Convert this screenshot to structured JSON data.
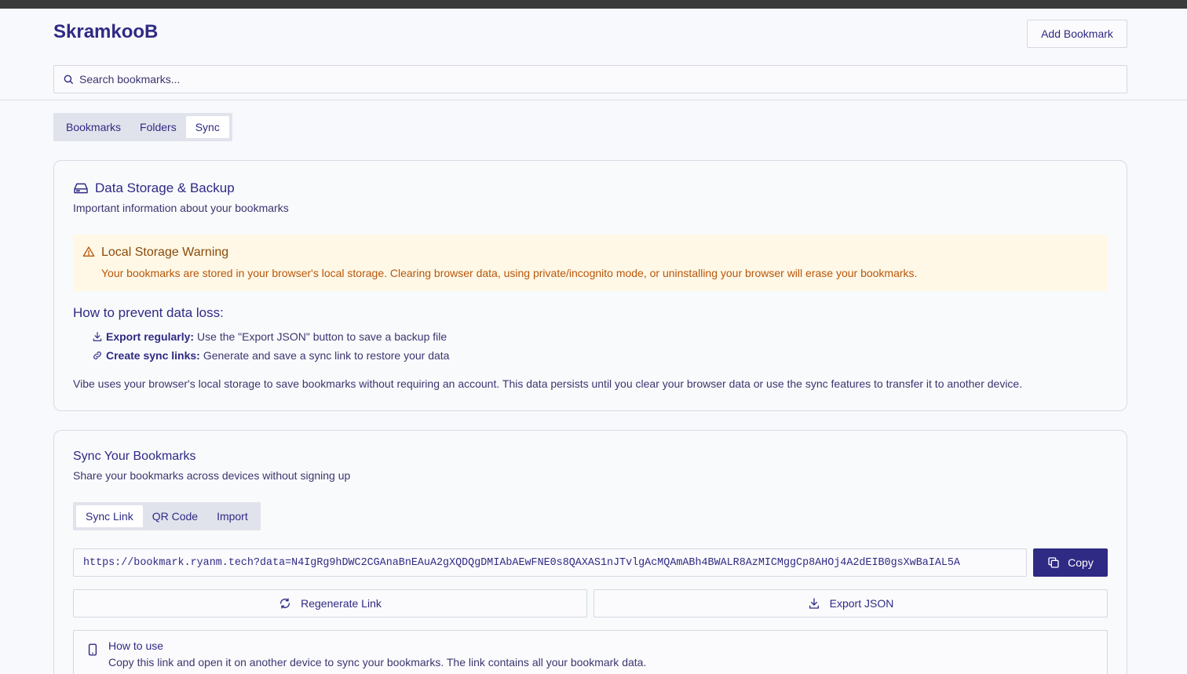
{
  "app": {
    "title": "SkramkooB",
    "add_button": "Add Bookmark"
  },
  "search": {
    "placeholder": "Search bookmarks..."
  },
  "main_tabs": [
    {
      "label": "Bookmarks",
      "active": false
    },
    {
      "label": "Folders",
      "active": false
    },
    {
      "label": "Sync",
      "active": true
    }
  ],
  "storage_card": {
    "title": "Data Storage & Backup",
    "subtitle": "Important information about your bookmarks",
    "warning": {
      "title": "Local Storage Warning",
      "text": "Your bookmarks are stored in your browser's local storage. Clearing browser data, using private/incognito mode, or uninstalling your browser will erase your bookmarks."
    },
    "prevent_title": "How to prevent data loss:",
    "prevent_items": [
      {
        "bold": "Export regularly:",
        "rest": "Use the \"Export JSON\" button to save a backup file",
        "icon": "download-icon"
      },
      {
        "bold": "Create sync links:",
        "rest": "Generate and save a sync link to restore your data",
        "icon": "link-icon"
      }
    ],
    "paragraph": "Vibe uses your browser's local storage to save bookmarks without requiring an account. This data persists until you clear your browser data or use the sync features to transfer it to another device."
  },
  "sync_card": {
    "title": "Sync Your Bookmarks",
    "subtitle": "Share your bookmarks across devices without signing up",
    "tabs": [
      {
        "label": "Sync Link",
        "active": true
      },
      {
        "label": "QR Code",
        "active": false
      },
      {
        "label": "Import",
        "active": false
      }
    ],
    "sync_url": "https://bookmark.ryanm.tech?data=N4IgRg9hDWC2CGAnaBnEAuA2gXQDQgDMIAbAEwFNE0s8QAXAS1nJTvlgAcMQAmABh4BWALR8AzMICMggCp8AHOj4A2dEIB0gsXwBaIAL5A",
    "copy_button": "Copy",
    "regenerate_button": "Regenerate Link",
    "export_button": "Export JSON",
    "howto": {
      "title": "How to use",
      "text": "Copy this link and open it on another device to sync your bookmarks. The link contains all your bookmark data."
    }
  },
  "colors": {
    "accent": "#2f2a84",
    "warning_bg": "#fff8e6",
    "warning_text": "#b8560a",
    "background": "#f8f9fc"
  }
}
